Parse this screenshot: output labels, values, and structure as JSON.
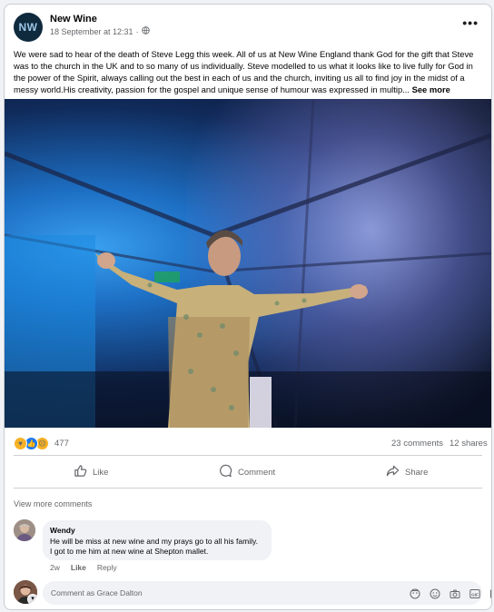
{
  "post": {
    "page_name": "New Wine",
    "avatar_text": "NW",
    "date": "18 September at 12:31",
    "separator": "·",
    "text": "We were sad to hear of the death of Steve Legg this week. All of us at New Wine England thank God for the gift that Steve was to the church in the UK and to so many of us individually. Steve modelled to us what it looks like to live fully for God in the power of the Spirit, always calling out the best in each of us and the church, inviting us all to find joy in the midst of a messy world.His creativity, passion for the gospel and unique sense of humour was expressed in multip...",
    "see_more": "See more"
  },
  "reactions": {
    "count": "477",
    "comments": "23 comments",
    "shares": "12 shares",
    "icons": [
      "care-emoji",
      "like-emoji",
      "sad-emoji"
    ]
  },
  "actions": {
    "like": "Like",
    "comment": "Comment",
    "share": "Share"
  },
  "comments": {
    "view_more": "View more comments",
    "items": [
      {
        "name": "Wendy",
        "text_line1": "He will be miss at new wine and my prays go to all his family.",
        "text_line2": "I got to me him at new wine at Shepton mallet.",
        "time": "2w",
        "like": "Like",
        "reply": "Reply"
      }
    ],
    "input_placeholder": "Comment as Grace Dalton"
  },
  "colors": {
    "avatar_bg": "#0f2a3d",
    "muted_text": "#65676b",
    "like_blue": "#1877f2"
  }
}
